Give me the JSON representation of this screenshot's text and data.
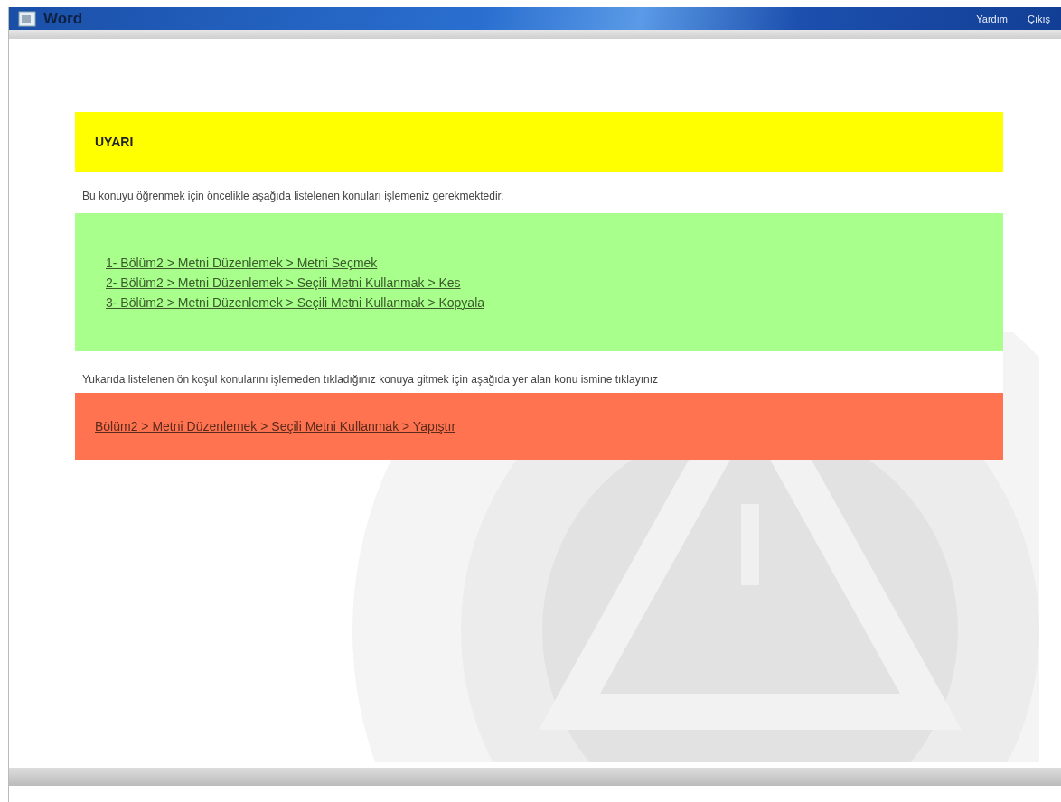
{
  "header": {
    "logo": "Word",
    "links": [
      "Yardım",
      "Çıkış"
    ]
  },
  "warning": {
    "title": "UYARI"
  },
  "intro": "Bu konuyu öğrenmek için öncelikle aşağıda listelenen konuları işlemeniz gerekmektedir.",
  "prerequisites": [
    "1- Bölüm2 > Metni Düzenlemek > Metni Seçmek",
    "2- Bölüm2 > Metni Düzenlemek > Seçili Metni Kullanmak > Kes",
    "3- Bölüm2 > Metni Düzenlemek > Seçili Metni Kullanmak > Kopyala"
  ],
  "skip_note": "Yukarıda listelenen ön koşul konularını işlemeden tıkladığınız konuya gitmek için aşağıda yer alan konu ismine tıklayınız",
  "target_link": "Bölüm2 > Metni Düzenlemek > Seçili Metni Kullanmak > Yapıştır"
}
